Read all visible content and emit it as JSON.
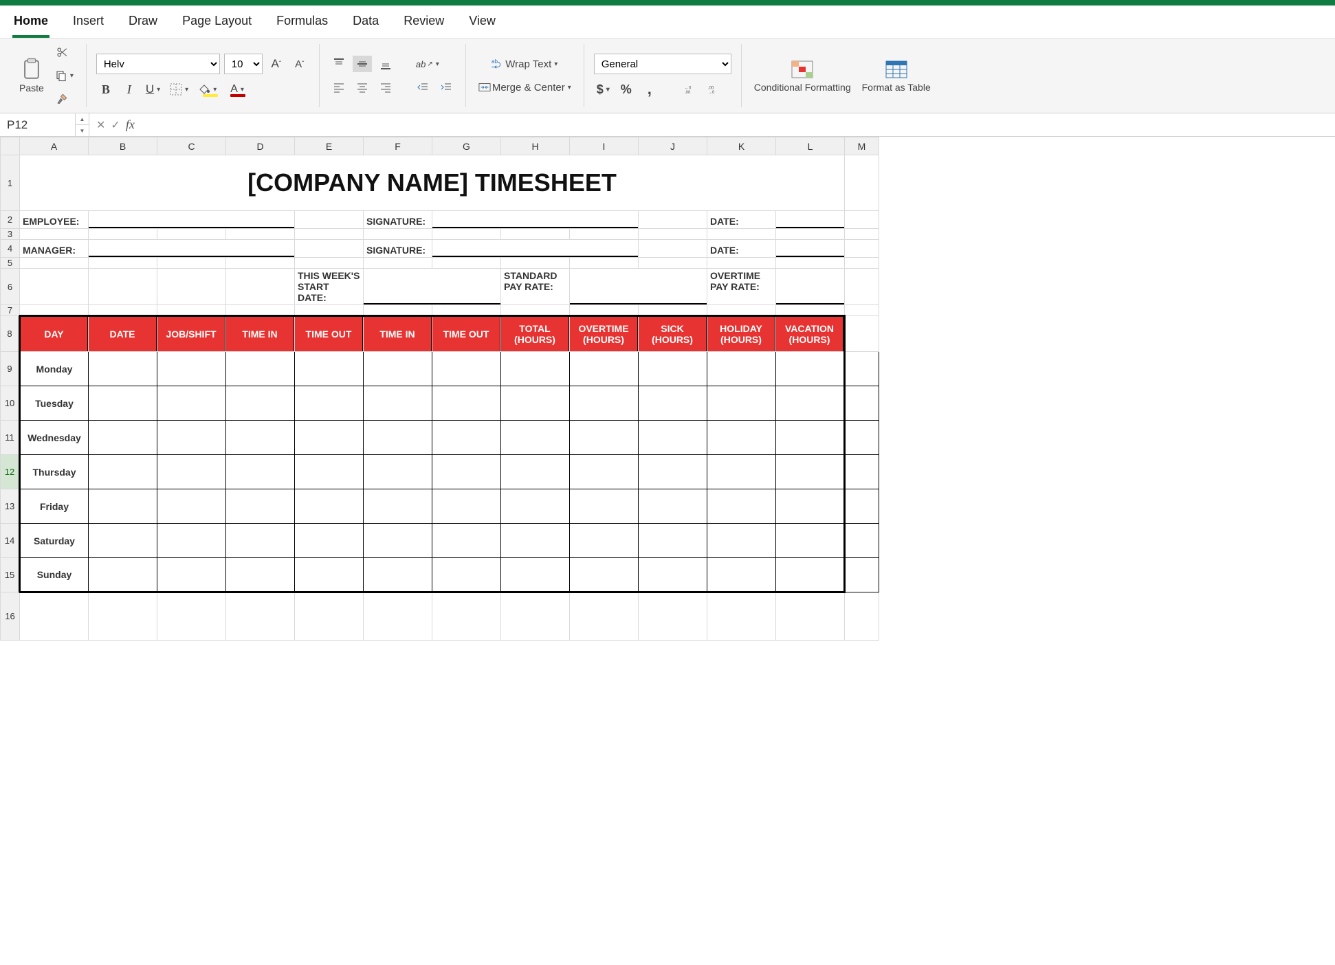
{
  "tabs": [
    "Home",
    "Insert",
    "Draw",
    "Page Layout",
    "Formulas",
    "Data",
    "Review",
    "View"
  ],
  "activeTab": "Home",
  "clipboard": {
    "pasteLabel": "Paste"
  },
  "font": {
    "name": "Helv",
    "size": "10"
  },
  "wrapText": "Wrap Text",
  "mergeCenter": "Merge & Center",
  "numberFormat": "General",
  "condFormat": "Conditional Formatting",
  "formatTable": "Format as Table",
  "nameBox": "P12",
  "formula": "",
  "cols": [
    "A",
    "B",
    "C",
    "D",
    "E",
    "F",
    "G",
    "H",
    "I",
    "J",
    "K",
    "L",
    "M"
  ],
  "colWidths": [
    "cA",
    "cB",
    "cC",
    "cD",
    "cE",
    "cF",
    "cG",
    "cH",
    "cI",
    "cJ",
    "cK",
    "cL",
    "cM"
  ],
  "rows": [
    1,
    2,
    3,
    4,
    5,
    6,
    7,
    8,
    9,
    10,
    11,
    12,
    13,
    14,
    15,
    16
  ],
  "sheet": {
    "title": "[COMPANY NAME] TIMESHEET",
    "employeeLabel": "EMPLOYEE:",
    "managerLabel": "MANAGER:",
    "signatureLabel": "SIGNATURE:",
    "dateLabel": "DATE:",
    "weekStartLabel1": "THIS WEEK'S",
    "weekStartLabel2": "START DATE:",
    "stdPay1": "STANDARD",
    "stdPay2": "PAY RATE:",
    "otPay1": "OVERTIME",
    "otPay2": "PAY RATE:",
    "headers": [
      "DAY",
      "DATE",
      "JOB/SHIFT",
      "TIME IN",
      "TIME OUT",
      "TIME IN",
      "TIME OUT",
      "TOTAL (HOURS)",
      "OVERTIME (HOURS)",
      "SICK (HOURS)",
      "HOLIDAY (HOURS)",
      "VACATION (HOURS)"
    ],
    "days": [
      "Monday",
      "Tuesday",
      "Wednesday",
      "Thursday",
      "Friday",
      "Saturday",
      "Sunday"
    ]
  },
  "selectedRow": 12
}
